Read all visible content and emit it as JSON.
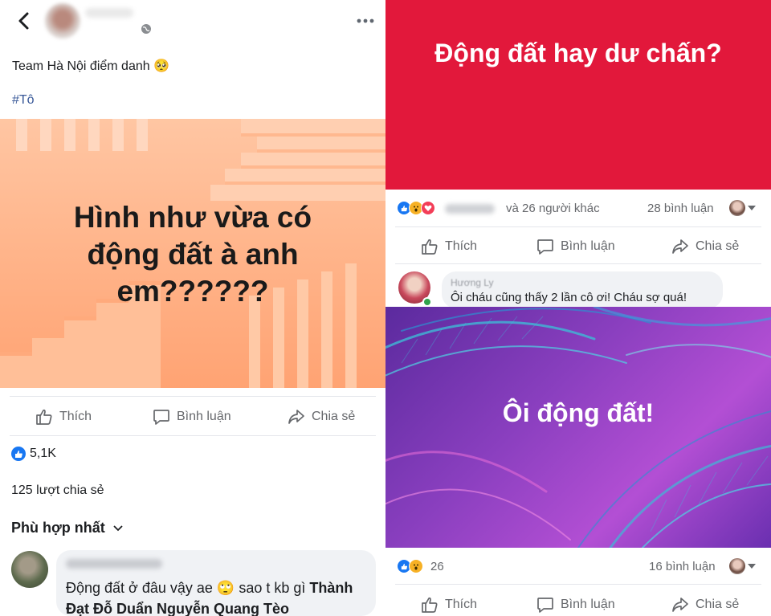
{
  "left": {
    "post_text": "Team Hà Nội điểm danh 🥺",
    "hashtag": "#Tô",
    "card": {
      "line1": "Hình như vừa có",
      "line2": "động đất à anh",
      "line3": "em??????"
    },
    "actions": {
      "like": "Thích",
      "comment": "Bình luận",
      "share": "Chia sẻ"
    },
    "like_count": "5,1K",
    "share_count": "125 lượt chia sẻ",
    "sort_label": "Phù hợp nhất",
    "comment": {
      "text_plain": "Động đất ở đâu vậy ae 🙄 sao t kb gì ",
      "text_bold": "Thành Đạt Đỗ Duẩn Nguyễn Quang Tèo"
    }
  },
  "right": {
    "card1_title": "Động đất hay dư chấn?",
    "post1": {
      "others": "và 26 người khác",
      "comments": "28 bình luận"
    },
    "actions": {
      "like": "Thích",
      "comment": "Bình luận",
      "share": "Chia sẻ"
    },
    "comment": {
      "name": "Hương Ly",
      "text": "Ôi cháu cũng thấy 2 lần cô ơi! Cháu sợ quá!"
    },
    "card2_title": "Ôi động đất!",
    "post2": {
      "reaction_count": "26",
      "comments": "16 bình luận"
    }
  },
  "colors": {
    "red_card": "#e2183b",
    "facebook_blue": "#1877f2",
    "hashtag": "#385898",
    "muted": "#65676b"
  }
}
